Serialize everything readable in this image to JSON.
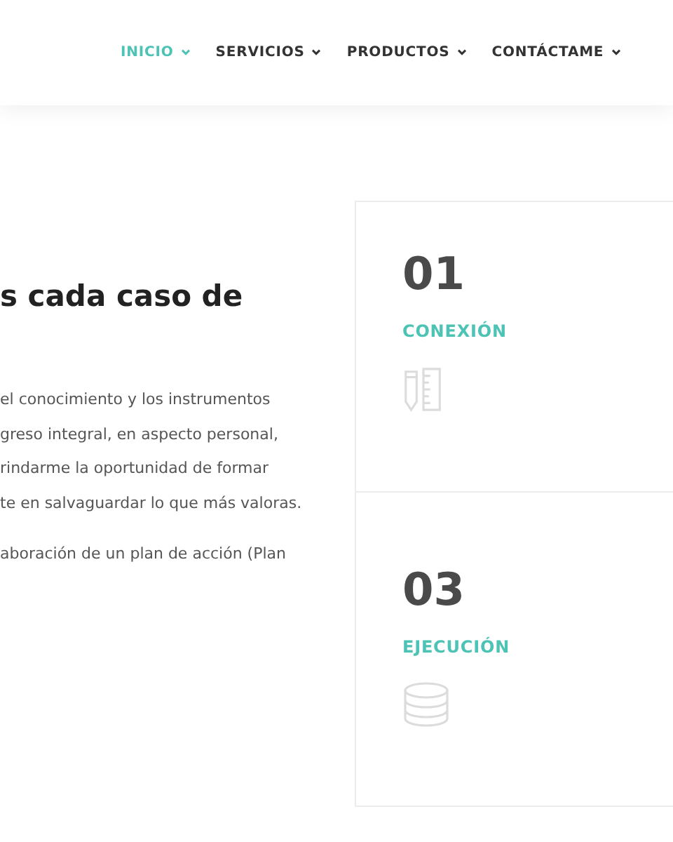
{
  "nav": [
    {
      "label": "INICIO",
      "selected": true
    },
    {
      "label": "SERVICIOS",
      "selected": false
    },
    {
      "label": "PRODUCTOS",
      "selected": false
    },
    {
      "label": "CONTÁCTAME",
      "selected": false
    }
  ],
  "intro": {
    "title": "s cada caso de",
    "lines": [
      "el conocimiento y los instrumentos",
      "greso integral, en aspecto personal,",
      "rindarme la oportunidad de formar",
      "te en salvaguardar lo que más valoras."
    ],
    "extra": "aboración de un plan de acción (Plan"
  },
  "steps": [
    {
      "number": "01",
      "label": "CONEXIÓN"
    },
    {
      "number": "03",
      "label": "EJECUCIÓN"
    }
  ]
}
